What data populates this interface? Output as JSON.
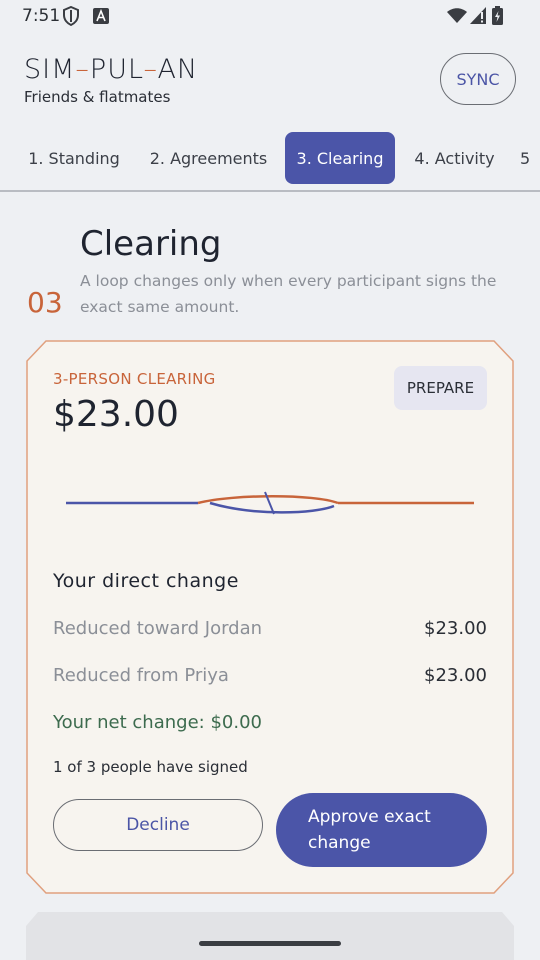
{
  "status_bar": {
    "time": "7:51"
  },
  "header": {
    "brand_parts": [
      "SIM",
      "PUL",
      "AN"
    ],
    "subtitle": "Friends & flatmates",
    "sync_label": "SYNC"
  },
  "tabs": [
    {
      "label": "1. Standing"
    },
    {
      "label": "2. Agreements"
    },
    {
      "label": "3. Clearing",
      "active": true
    },
    {
      "label": "4. Activity"
    },
    {
      "label": "5"
    }
  ],
  "section": {
    "number": "03",
    "title": "Clearing",
    "description": "A loop changes only when every participant signs the exact same amount."
  },
  "card": {
    "kicker": "3-PERSON CLEARING",
    "amount": "$23.00",
    "prepare_label": "PREPARE",
    "direct_change_title": "Your direct change",
    "rows": [
      {
        "label": "Reduced toward Jordan",
        "value": "$23.00"
      },
      {
        "label": "Reduced from Priya",
        "value": "$23.00"
      }
    ],
    "net_change": "Your net change: $0.00",
    "signed_status": "1 of 3 people have signed",
    "decline_label": "Decline",
    "approve_label": "Approve exact change"
  },
  "colors": {
    "accent": "#4b55a8",
    "brand_orange": "#c8643a",
    "net_green": "#3d6b4e",
    "card_bg": "#f7f4ef"
  }
}
